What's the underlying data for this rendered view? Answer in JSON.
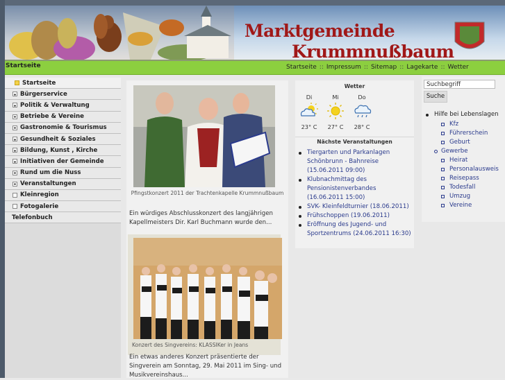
{
  "header": {
    "title_line1": "Marktgemeinde",
    "title_line2": "Krummnußbaum"
  },
  "breadcrumb": {
    "home": "Startseite"
  },
  "topnav": [
    "Startseite",
    "Impressum",
    "Sitemap",
    "Lagekarte",
    "Wetter"
  ],
  "sidebar": {
    "items": [
      {
        "label": "Startseite",
        "icon": "square-icon",
        "active": true
      },
      {
        "label": "Bürgerservice",
        "icon": "plus-icon"
      },
      {
        "label": "Politik & Verwaltung",
        "icon": "plus-icon"
      },
      {
        "label": "Betriebe & Vereine",
        "icon": "plus-icon"
      },
      {
        "label": "Gastronomie & Tourismus",
        "icon": "plus-icon"
      },
      {
        "label": "Gesundheit & Soziales",
        "icon": "plus-icon"
      },
      {
        "label": "Bildung, Kunst , Kirche",
        "icon": "plus-icon"
      },
      {
        "label": "Initiativen der Gemeinde",
        "icon": "plus-icon"
      },
      {
        "label": "Rund um die Nuss",
        "icon": "plus-icon"
      },
      {
        "label": "Veranstaltungen",
        "icon": "plus-icon"
      },
      {
        "label": "Kleinregion",
        "icon": "square-icon"
      },
      {
        "label": "Fotogalerie",
        "icon": "square-icon"
      },
      {
        "label": "Telefonbuch",
        "icon": "none"
      }
    ]
  },
  "news": [
    {
      "caption": "Pfingstkonzert 2011 der Trachtenkapelle Krummnußbaum",
      "text": "Ein würdiges Abschlusskonzert des langjährigen Kapellmeisters Dir. Karl Buchmann wurde den..."
    },
    {
      "caption": "Konzert des Singvereins: KLASSIKer in Jeans",
      "text": "Ein etwas anderes Konzert präsentierte der Singverein am Sonntag, 29. Mai 2011 im Sing- und Musikvereinshaus..."
    }
  ],
  "weather": {
    "title": "Wetter",
    "days": [
      {
        "day": "Di",
        "icon": "sun-cloud-icon",
        "temp": "23° C"
      },
      {
        "day": "Mi",
        "icon": "sun-icon",
        "temp": "27° C"
      },
      {
        "day": "Do",
        "icon": "rain-cloud-icon",
        "temp": "28° C"
      }
    ]
  },
  "events": {
    "title": "Nächste Veranstaltungen",
    "items": [
      "Tiergarten und Parkanlagen Schönbrunn - Bahnreise (15.06.2011 09:00)",
      "Klubnachmittag des Pensionistenverbandes (16.06.2011 15:00)",
      "SVK- Kleinfeldturnier (18.06.2011)",
      "Frühschoppen (19.06.2011)",
      "Eröffnung des Jugend- und Sportzentrums (24.06.2011 16:30)"
    ]
  },
  "search": {
    "value": "Suchbegriff",
    "button": "Suche"
  },
  "quicklinks": {
    "title": "Hilfe bei Lebenslagen",
    "items": [
      {
        "label": "Kfz",
        "level": 1
      },
      {
        "label": "Führerschein",
        "level": 1
      },
      {
        "label": "Geburt",
        "level": 1
      },
      {
        "label": "Gewerbe",
        "level": 0
      },
      {
        "label": "Heirat",
        "level": 1
      },
      {
        "label": "Personalausweis",
        "level": 1
      },
      {
        "label": "Reisepass",
        "level": 1
      },
      {
        "label": "Todesfall",
        "level": 1
      },
      {
        "label": "Umzug",
        "level": 1
      },
      {
        "label": "Vereine",
        "level": 1
      }
    ]
  },
  "colors": {
    "nav_green": "#8ccf3f",
    "title_red": "#a01818",
    "link_blue": "#2a3a8c"
  }
}
